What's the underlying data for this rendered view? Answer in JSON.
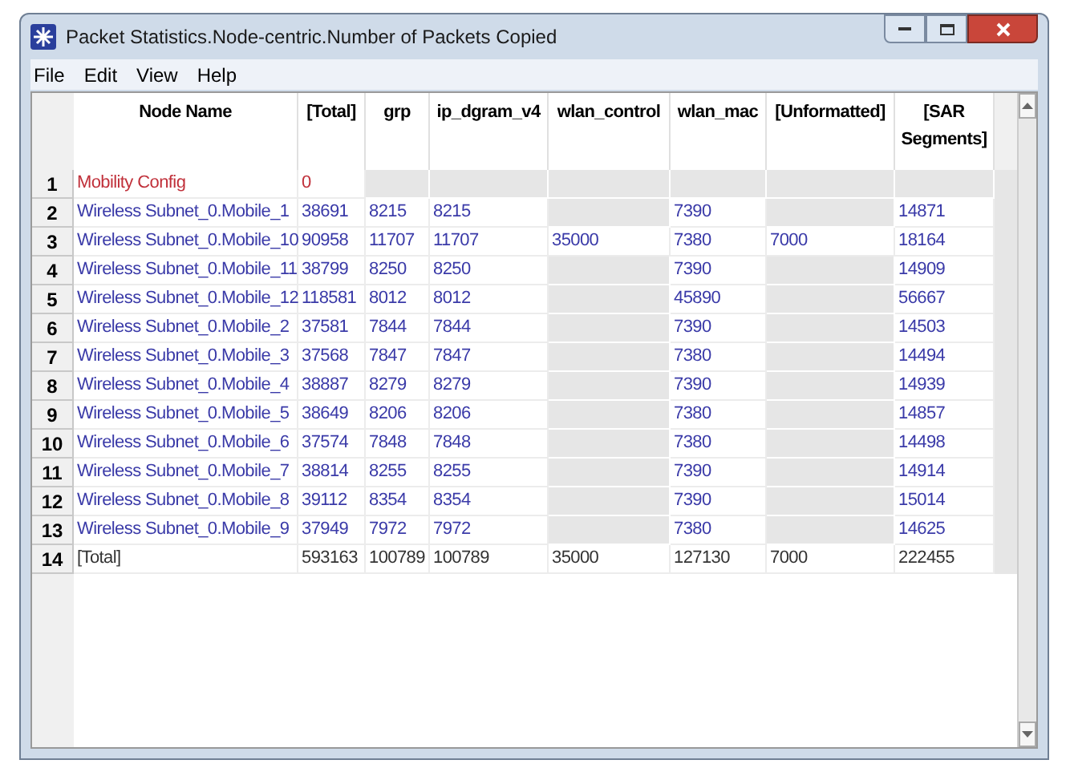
{
  "window": {
    "title": "Packet Statistics.Node-centric.Number of Packets Copied"
  },
  "menu": [
    "File",
    "Edit",
    "View",
    "Help"
  ],
  "table": {
    "columns": [
      "Node Name",
      "[Total]",
      "grp",
      "ip_dgram_v4",
      "wlan_control",
      "wlan_mac",
      "[Unformatted]",
      "[SAR Segments]"
    ],
    "rows": [
      {
        "index": "1",
        "kind": "config",
        "cells": [
          "Mobility Config",
          "0",
          null,
          null,
          null,
          null,
          null,
          null
        ]
      },
      {
        "index": "2",
        "kind": "node",
        "cells": [
          "Wireless Subnet_0.Mobile_1",
          "38691",
          "8215",
          "8215",
          null,
          "7390",
          null,
          "14871"
        ]
      },
      {
        "index": "3",
        "kind": "node",
        "cells": [
          "Wireless Subnet_0.Mobile_10",
          "90958",
          "11707",
          "11707",
          "35000",
          "7380",
          "7000",
          "18164"
        ]
      },
      {
        "index": "4",
        "kind": "node",
        "cells": [
          "Wireless Subnet_0.Mobile_11",
          "38799",
          "8250",
          "8250",
          null,
          "7390",
          null,
          "14909"
        ]
      },
      {
        "index": "5",
        "kind": "node",
        "cells": [
          "Wireless Subnet_0.Mobile_12",
          "118581",
          "8012",
          "8012",
          null,
          "45890",
          null,
          "56667"
        ]
      },
      {
        "index": "6",
        "kind": "node",
        "cells": [
          "Wireless Subnet_0.Mobile_2",
          "37581",
          "7844",
          "7844",
          null,
          "7390",
          null,
          "14503"
        ]
      },
      {
        "index": "7",
        "kind": "node",
        "cells": [
          "Wireless Subnet_0.Mobile_3",
          "37568",
          "7847",
          "7847",
          null,
          "7380",
          null,
          "14494"
        ]
      },
      {
        "index": "8",
        "kind": "node",
        "cells": [
          "Wireless Subnet_0.Mobile_4",
          "38887",
          "8279",
          "8279",
          null,
          "7390",
          null,
          "14939"
        ]
      },
      {
        "index": "9",
        "kind": "node",
        "cells": [
          "Wireless Subnet_0.Mobile_5",
          "38649",
          "8206",
          "8206",
          null,
          "7380",
          null,
          "14857"
        ]
      },
      {
        "index": "10",
        "kind": "node",
        "cells": [
          "Wireless Subnet_0.Mobile_6",
          "37574",
          "7848",
          "7848",
          null,
          "7380",
          null,
          "14498"
        ]
      },
      {
        "index": "11",
        "kind": "node",
        "cells": [
          "Wireless Subnet_0.Mobile_7",
          "38814",
          "8255",
          "8255",
          null,
          "7390",
          null,
          "14914"
        ]
      },
      {
        "index": "12",
        "kind": "node",
        "cells": [
          "Wireless Subnet_0.Mobile_8",
          "39112",
          "8354",
          "8354",
          null,
          "7390",
          null,
          "15014"
        ]
      },
      {
        "index": "13",
        "kind": "node",
        "cells": [
          "Wireless Subnet_0.Mobile_9",
          "37949",
          "7972",
          "7972",
          null,
          "7380",
          null,
          "14625"
        ]
      },
      {
        "index": "14",
        "kind": "total",
        "cells": [
          "[Total]",
          "593163",
          "100789",
          "100789",
          "35000",
          "127130",
          "7000",
          "222455"
        ]
      }
    ]
  }
}
